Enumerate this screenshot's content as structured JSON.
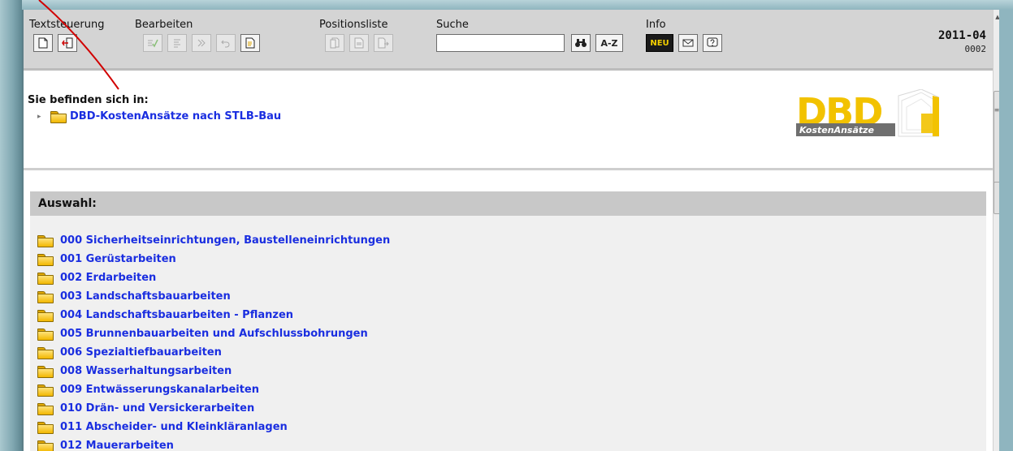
{
  "toolbar": {
    "groups": {
      "textsteuerung": "Textsteuerung",
      "bearbeiten": "Bearbeiten",
      "positionsliste": "Positionsliste",
      "suche": "Suche",
      "info": "Info"
    },
    "buttons": {
      "az_label": "A-Z",
      "neu_label": "NEU"
    },
    "search": {
      "value": "",
      "placeholder": ""
    },
    "version": {
      "release": "2011-04",
      "number": "0002"
    }
  },
  "breadcrumb": {
    "title": "Sie befinden sich in:",
    "item": "DBD-KostenAnsätze nach STLB-Bau"
  },
  "logo": {
    "main": "DBD",
    "sub": "KostenAnsätze"
  },
  "auswahl": {
    "title": "Auswahl:",
    "items": [
      "000 Sicherheitseinrichtungen, Baustelleneinrichtungen",
      "001 Gerüstarbeiten",
      "002 Erdarbeiten",
      "003 Landschaftsbauarbeiten",
      "004 Landschaftsbauarbeiten - Pflanzen",
      "005 Brunnenbauarbeiten und Aufschlussbohrungen",
      "006 Spezialtiefbauarbeiten",
      "008 Wasserhaltungsarbeiten",
      "009 Entwässerungskanalarbeiten",
      "010 Drän- und Versickerarbeiten",
      "011 Abscheider- und Kleinkläranlagen",
      "012 Mauerarbeiten"
    ]
  },
  "colors": {
    "link": "#1a2ee0",
    "toolbar_bg": "#d4d4d4",
    "panel_header": "#c8c8c8",
    "logo_yellow": "#f2c200",
    "annotation_red": "#d10000"
  }
}
